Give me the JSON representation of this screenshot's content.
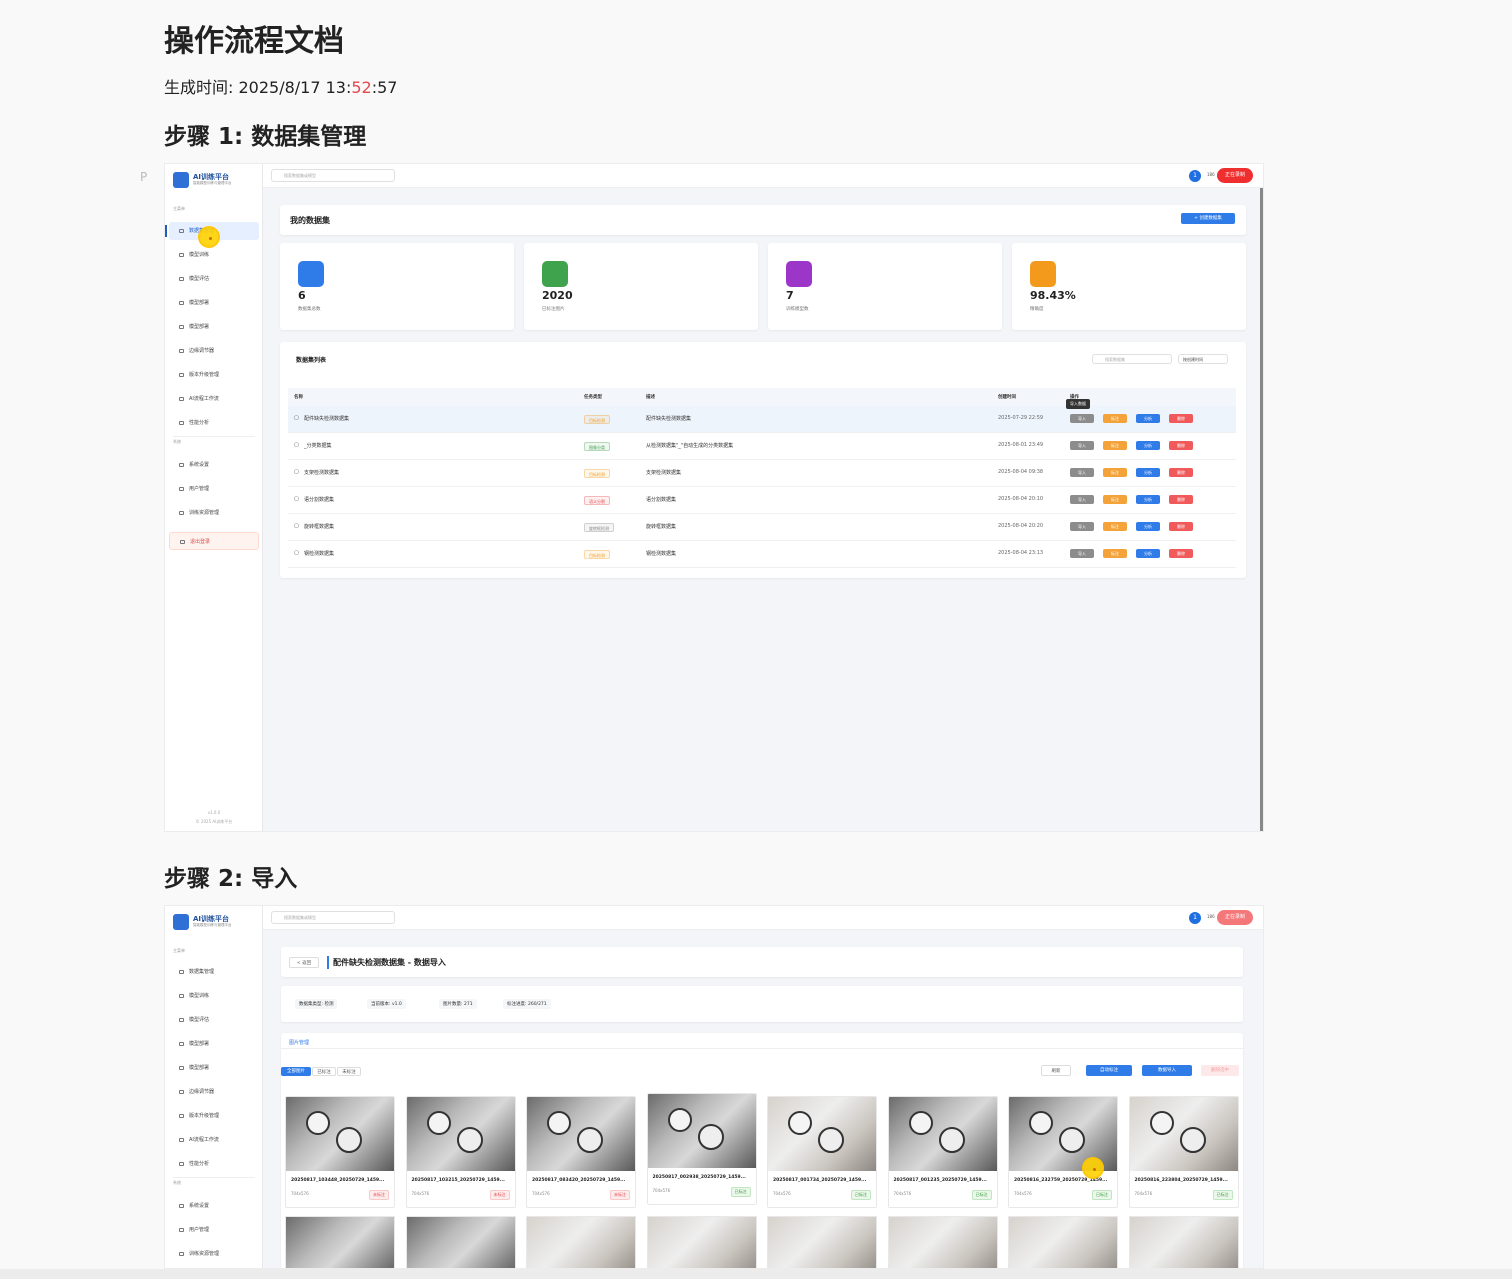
{
  "doc": {
    "title": "操作流程文档",
    "gen_prefix": "生成时间: 2025/8/17 13:",
    "gen_minute": "52",
    "gen_suffix": ":57",
    "p_mark": "P",
    "step1": "步骤 1: 数据集管理",
    "step2": "步骤 2: 导入"
  },
  "app": {
    "logo_title": "AI训练平台",
    "logo_sub": "智能模型训练与管理平台",
    "search_placeholder": "搜索数据集或模型",
    "notif_count": "1",
    "user": "186",
    "recording": "正在录制",
    "section_main": "主菜单",
    "section_system": "系统",
    "nav": [
      "数据集管理",
      "模型训练",
      "模型评估",
      "模型部署",
      "模型部署",
      "边缘调节器",
      "版本升级管理",
      "AI流程工作流",
      "性能分析"
    ],
    "nav_system": [
      "系统设置",
      "用户管理",
      "训练资源管理"
    ],
    "logout": "退出登录",
    "version": "v1.0.0",
    "copyright": "© 2025 AI训练平台"
  },
  "datasets_page": {
    "title": "我的数据集",
    "create_btn": "+ 创建数据集",
    "stats": [
      {
        "value": "6",
        "label": "数据集总数",
        "color": "#2f7be8"
      },
      {
        "value": "2020",
        "label": "已标注图片",
        "color": "#3fa34d"
      },
      {
        "value": "7",
        "label": "训练模型数",
        "color": "#9c36c9"
      },
      {
        "value": "98.43%",
        "label": "精确度",
        "color": "#f39a1c"
      }
    ],
    "list_title": "数据集列表",
    "filter_placeholder": "搜索数据集",
    "sort_label": "按创建时间",
    "headers": [
      "名称",
      "任务类型",
      "描述",
      "创建时间",
      "操作"
    ],
    "tooltip": "导入数据",
    "rows": [
      {
        "name": "配件缺失检测数据集",
        "type": "目标检测",
        "type_color": "#f39a1c",
        "desc": "配件缺失检测数据集",
        "time": "2025-07-29 22:59"
      },
      {
        "name": "_分类数据集",
        "type": "图像分类",
        "type_color": "#3fa34d",
        "desc": "从检测数据集\"_\"自动生成的分类数据集",
        "time": "2025-08-01 23:49"
      },
      {
        "name": "支架检测数据集",
        "type": "目标检测",
        "type_color": "#f39a1c",
        "desc": "支架检测数据集",
        "time": "2025-08-04 09:38"
      },
      {
        "name": "语分割数据集",
        "type": "语义分割",
        "type_color": "#e5484d",
        "desc": "语分割数据集",
        "time": "2025-08-04 20:10"
      },
      {
        "name": "旋转框数据集",
        "type": "旋转框检测",
        "type_color": "#888888",
        "desc": "旋转框数据集",
        "time": "2025-08-04 20:20"
      },
      {
        "name": "钢检测数据集",
        "type": "目标检测",
        "type_color": "#f39a1c",
        "desc": "钢检测数据集",
        "time": "2025-08-04 23:13"
      }
    ],
    "actions": [
      "导入",
      "标注",
      "分析",
      "删除"
    ]
  },
  "import_page": {
    "back": "< 返回",
    "title": "配件缺失检测数据集 - 数据导入",
    "info": [
      {
        "label": "数据集类型:",
        "value": "检测"
      },
      {
        "label": "当前版本:",
        "value": "v1.0"
      },
      {
        "label": "图片数量:",
        "value": "271"
      },
      {
        "label": "标注进度:",
        "value": "260/271"
      }
    ],
    "tab": "图片管理",
    "filters": [
      "全部图片",
      "已标注",
      "未标注"
    ],
    "refresh": "刷新",
    "auto_label": "自动标注",
    "data_import": "数据导入",
    "delete_selected": "删除选中",
    "images": [
      {
        "name": "20250817_103448_20250729_1459...",
        "size": "704x576",
        "status": "未标注",
        "color": "red"
      },
      {
        "name": "20250817_103215_20250729_1459...",
        "size": "704x576",
        "status": "未标注",
        "color": "red"
      },
      {
        "name": "20250817_083420_20250729_1459...",
        "size": "704x576",
        "status": "未标注",
        "color": "red"
      },
      {
        "name": "20250817_002938_20250729_1459...",
        "size": "704x576",
        "status": "已标注",
        "color": "green"
      },
      {
        "name": "20250817_001734_20250729_1459...",
        "size": "704x576",
        "status": "已标注",
        "color": "green"
      },
      {
        "name": "20250817_001235_20250729_1459...",
        "size": "704x576",
        "status": "已标注",
        "color": "green"
      },
      {
        "name": "20250816_232759_20250729_1459...",
        "size": "704x576",
        "status": "已标注",
        "color": "green"
      },
      {
        "name": "20250816_223804_20250729_1459...",
        "size": "704x576",
        "status": "已标注",
        "color": "green"
      }
    ]
  }
}
